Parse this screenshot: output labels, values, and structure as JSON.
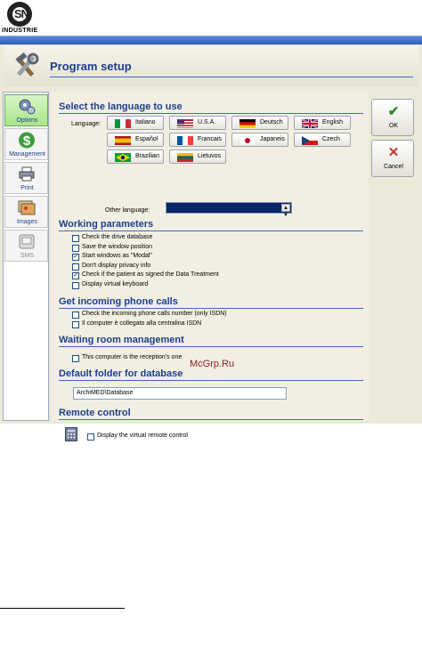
{
  "logo": {
    "mark": "SN",
    "brand": "INDUSTRIE"
  },
  "window": {
    "title": "Program setup"
  },
  "sidebar": {
    "items": [
      {
        "label": "Options",
        "icon": "options-gears-icon",
        "active": true
      },
      {
        "label": "Management",
        "icon": "dollar-icon",
        "active": false
      },
      {
        "label": "Print",
        "icon": "printer-icon",
        "active": false
      },
      {
        "label": "Images",
        "icon": "images-icon",
        "active": false
      },
      {
        "label": "SMS",
        "icon": "sms-icon",
        "active": false,
        "disabled": true
      }
    ]
  },
  "language": {
    "section_title": "Select the language to use",
    "label": "Language:",
    "buttons": [
      {
        "name": "Italiano",
        "flag": "it"
      },
      {
        "name": "U.S.A.",
        "flag": "us"
      },
      {
        "name": "Deutsch",
        "flag": "de"
      },
      {
        "name": "English",
        "flag": "gb"
      },
      {
        "name": "Español",
        "flag": "es"
      },
      {
        "name": "Francais",
        "flag": "fr"
      },
      {
        "name": "Japaneis",
        "flag": "jp"
      },
      {
        "name": "Czech",
        "flag": "cz"
      },
      {
        "name": "Brazilian",
        "flag": "br"
      },
      {
        "name": "Lietuvos",
        "flag": "lt"
      }
    ],
    "other_label": "Other language:",
    "other_value": ""
  },
  "working": {
    "section_title": "Working parameters",
    "options": [
      {
        "label": "Check the drive database",
        "checked": false
      },
      {
        "label": "Save the window position",
        "checked": false
      },
      {
        "label": "Start windows as \"Modal\"",
        "checked": true
      },
      {
        "label": "Don't display privacy info",
        "checked": false
      },
      {
        "label": "Check if the patient as signed the Data Treatment",
        "checked": true
      },
      {
        "label": "Display virtual keyboard",
        "checked": false
      }
    ]
  },
  "phone": {
    "section_title": "Get incoming phone calls",
    "options": [
      {
        "label": "Check the incoming phone calls number (only ISDN)",
        "checked": false
      },
      {
        "label": "Il computer è collegato alla centralina ISDN",
        "checked": false
      }
    ]
  },
  "waiting": {
    "section_title": "Waiting room management",
    "options": [
      {
        "label": "This computer is the reception's one",
        "checked": false
      }
    ]
  },
  "database": {
    "section_title": "Default folder for database",
    "value": "ArchiMED\\Database"
  },
  "remote": {
    "section_title": "Remote control",
    "options": [
      {
        "label": "Display the virtual remote control",
        "checked": false
      }
    ]
  },
  "actions": {
    "ok_label": "OK",
    "cancel_label": "Cancel"
  },
  "watermark": "McGrp.Ru"
}
